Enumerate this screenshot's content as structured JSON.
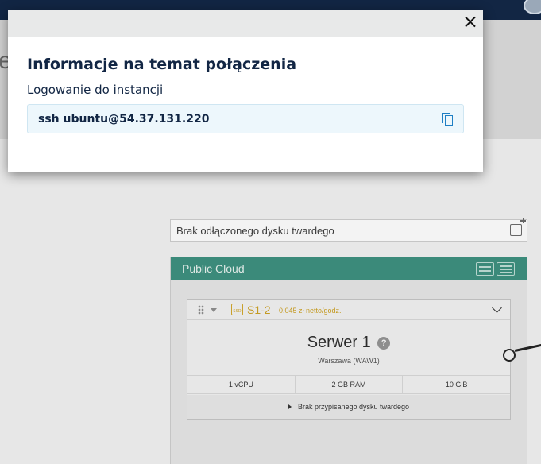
{
  "modal": {
    "title": "Informacje na temat połączenia",
    "subtitle": "Logowanie do instancji",
    "command": "ssh ubuntu@54.37.131.220"
  },
  "background": {
    "cut_letter": "e",
    "detached_disk_label": "Brak odłączonego dysku twardego",
    "panel_title": "Public Cloud",
    "server": {
      "plan": "S1-2",
      "price": "0.045 zł netto/godz.",
      "name": "Serwer 1",
      "location": "Warszawa (WAW1)",
      "specs": [
        "1 vCPU",
        "2 GB RAM",
        "10 GiB"
      ],
      "disk_label": "Brak przypisanego dysku twardego"
    }
  },
  "colors": {
    "topbar": "#122644",
    "panel_header": "#3b8a7a",
    "plan_accent": "#c49a22",
    "copy_icon": "#1f7fc4",
    "command_box": "#edf7fc"
  }
}
